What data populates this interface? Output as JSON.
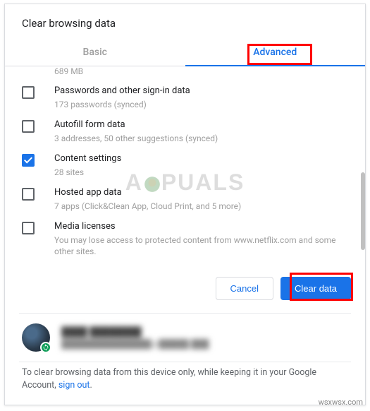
{
  "dialog": {
    "title": "Clear browsing data",
    "tabs": {
      "basic": "Basic",
      "advanced": "Advanced"
    },
    "truncated_top": "689 MB",
    "items": [
      {
        "title": "Passwords and other sign-in data",
        "subtitle": "173 passwords (synced)",
        "checked": false
      },
      {
        "title": "Autofill form data",
        "subtitle": "3 addresses, 50 other suggestions (synced)",
        "checked": false
      },
      {
        "title": "Content settings",
        "subtitle": "28 sites",
        "checked": true
      },
      {
        "title": "Hosted app data",
        "subtitle": "7 apps (Click&Clean App, Cloud Print, and 5 more)",
        "checked": false
      },
      {
        "title": "Media licenses",
        "subtitle": "You may lose access to protected content from www.netflix.com and some other sites.",
        "checked": false
      }
    ],
    "actions": {
      "cancel": "Cancel",
      "confirm": "Clear data"
    },
    "account": {
      "name_placeholder": "████ ████████",
      "email_placeholder": "███████████████@█████.███"
    },
    "footer": {
      "text_prefix": "To clear browsing data from this device only, while keeping it in your Google Account, ",
      "link": "sign out",
      "text_suffix": "."
    }
  },
  "watermark": "A PUALS",
  "credit": "wsxwsx.com"
}
